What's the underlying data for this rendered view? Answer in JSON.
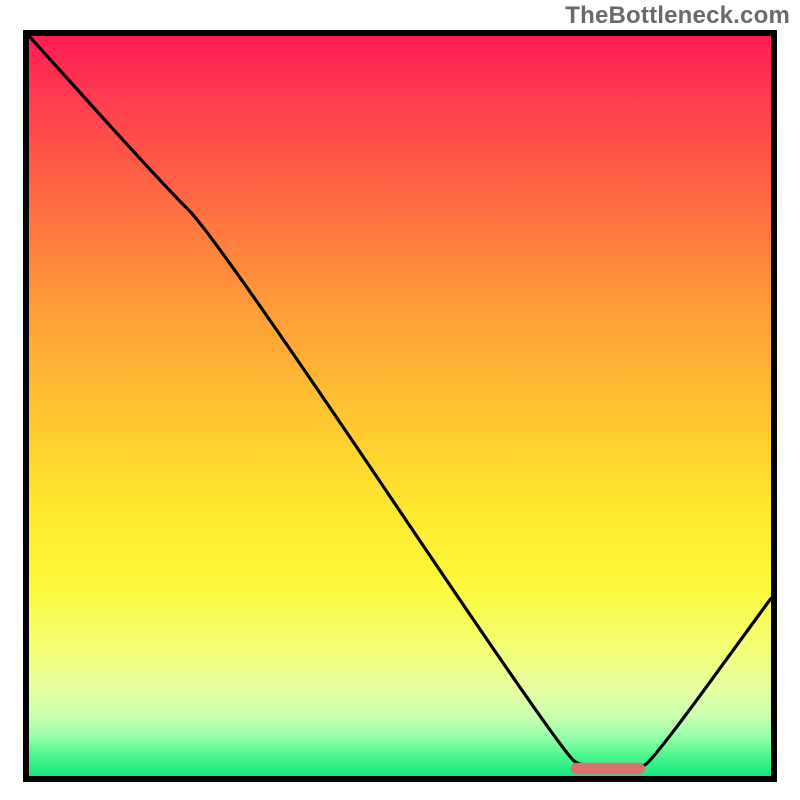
{
  "watermark": "TheBottleneck.com",
  "chart_data": {
    "type": "line",
    "title": "",
    "xlabel": "",
    "ylabel": "",
    "xlim": [
      0,
      100
    ],
    "ylim": [
      0,
      100
    ],
    "series": [
      {
        "name": "curve",
        "x": [
          0,
          18,
          25,
          72,
          75,
          82,
          84,
          100
        ],
        "values": [
          100,
          80,
          73,
          3,
          1,
          1,
          2,
          24
        ]
      }
    ],
    "marker": {
      "x": 78,
      "y": 1,
      "width": 10,
      "height": 1.6
    },
    "gradient_stops": [
      {
        "pct": 0,
        "color": "#ff1c54"
      },
      {
        "pct": 8,
        "color": "#ff3a4f"
      },
      {
        "pct": 22,
        "color": "#ff6a43"
      },
      {
        "pct": 36,
        "color": "#ff9a38"
      },
      {
        "pct": 50,
        "color": "#ffc232"
      },
      {
        "pct": 64,
        "color": "#ffe82f"
      },
      {
        "pct": 74,
        "color": "#fcf83a"
      },
      {
        "pct": 82,
        "color": "#f6ff70"
      },
      {
        "pct": 88,
        "color": "#e9ffa0"
      },
      {
        "pct": 92,
        "color": "#c8ffb0"
      },
      {
        "pct": 95,
        "color": "#8effa8"
      },
      {
        "pct": 97.5,
        "color": "#48f58e"
      },
      {
        "pct": 100,
        "color": "#16e97e"
      }
    ],
    "marker_color": "#d9716e"
  }
}
